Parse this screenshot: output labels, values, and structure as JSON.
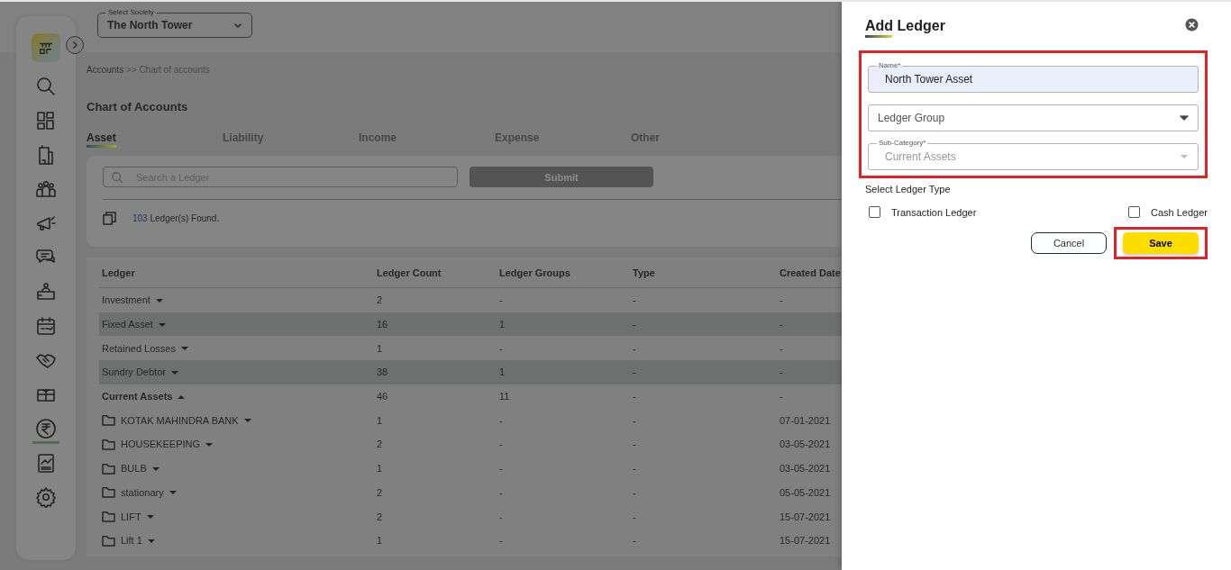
{
  "society": {
    "label": "Select Society",
    "value": "The North Tower"
  },
  "sidebar": {
    "items": [
      {
        "selected": false
      },
      {
        "selected": false
      },
      {
        "selected": false
      },
      {
        "selected": false
      },
      {
        "selected": false
      },
      {
        "selected": false
      },
      {
        "selected": false
      },
      {
        "selected": false
      },
      {
        "selected": false
      },
      {
        "selected": false
      },
      {
        "selected": true
      },
      {
        "selected": false
      },
      {
        "selected": false
      }
    ]
  },
  "breadcrumb": {
    "parent": "Accounts",
    "separator": ">>",
    "current": "Chart of accounts"
  },
  "title": "Chart of Accounts",
  "tabs": [
    {
      "label": "Asset",
      "selected": true
    },
    {
      "label": "Liability",
      "selected": false
    },
    {
      "label": "Income",
      "selected": false
    },
    {
      "label": "Expense",
      "selected": false
    },
    {
      "label": "Other",
      "selected": false
    }
  ],
  "search": {
    "placeholder": "Search a Ledger",
    "button": "Submit"
  },
  "found": {
    "count": "103",
    "text": "Ledger(s) Found."
  },
  "table": {
    "columns": [
      "Ledger",
      "Ledger Count",
      "Ledger Groups",
      "Type",
      "Created Date"
    ],
    "rows": [
      {
        "kind": "group",
        "expanded": false,
        "shaded": false,
        "cells": [
          "Investment",
          "2",
          "-",
          "-",
          "-"
        ]
      },
      {
        "kind": "group",
        "expanded": false,
        "shaded": true,
        "cells": [
          "Fixed Asset",
          "16",
          "1",
          "-",
          "-"
        ]
      },
      {
        "kind": "group",
        "expanded": false,
        "shaded": false,
        "cells": [
          "Retained Losses",
          "1",
          "-",
          "-",
          "-"
        ]
      },
      {
        "kind": "group",
        "expanded": false,
        "shaded": true,
        "cells": [
          "Sundry Debtor",
          "38",
          "1",
          "-",
          "-"
        ]
      },
      {
        "kind": "group",
        "expanded": true,
        "shaded": false,
        "cells": [
          "Current Assets",
          "46",
          "11",
          "-",
          "-"
        ]
      },
      {
        "kind": "child",
        "expanded": false,
        "shaded": false,
        "cells": [
          "KOTAK MAHINDRA BANK",
          "1",
          "-",
          "-",
          "07-01-2021"
        ]
      },
      {
        "kind": "child",
        "expanded": false,
        "shaded": false,
        "cells": [
          "HOUSEKEEPING",
          "2",
          "-",
          "-",
          "03-05-2021"
        ]
      },
      {
        "kind": "child",
        "expanded": false,
        "shaded": false,
        "cells": [
          "BULB",
          "1",
          "-",
          "-",
          "03-05-2021"
        ]
      },
      {
        "kind": "child",
        "expanded": false,
        "shaded": false,
        "cells": [
          "stationary",
          "2",
          "-",
          "-",
          "05-05-2021"
        ]
      },
      {
        "kind": "child",
        "expanded": false,
        "shaded": false,
        "cells": [
          "LIFT",
          "2",
          "-",
          "-",
          "15-07-2021"
        ]
      },
      {
        "kind": "child",
        "expanded": false,
        "shaded": false,
        "cells": [
          "Lift 1",
          "1",
          "-",
          "-",
          "15-07-2021"
        ]
      }
    ]
  },
  "panel": {
    "title": "Add Ledger",
    "highlighted": true,
    "name": {
      "label": "Name*",
      "value": "North Tower Asset"
    },
    "ledger_group": {
      "placeholder": "Ledger Group"
    },
    "sub_category": {
      "label": "Sub-Category*",
      "value": "Current Assets",
      "disabled": true
    },
    "type_label": "Select Ledger Type",
    "checkboxes": [
      {
        "label": "Transaction Ledger",
        "checked": false
      },
      {
        "label": "Cash Ledger",
        "checked": false
      }
    ],
    "cancel": "Cancel",
    "save": {
      "label": "Save",
      "highlighted": true
    }
  }
}
